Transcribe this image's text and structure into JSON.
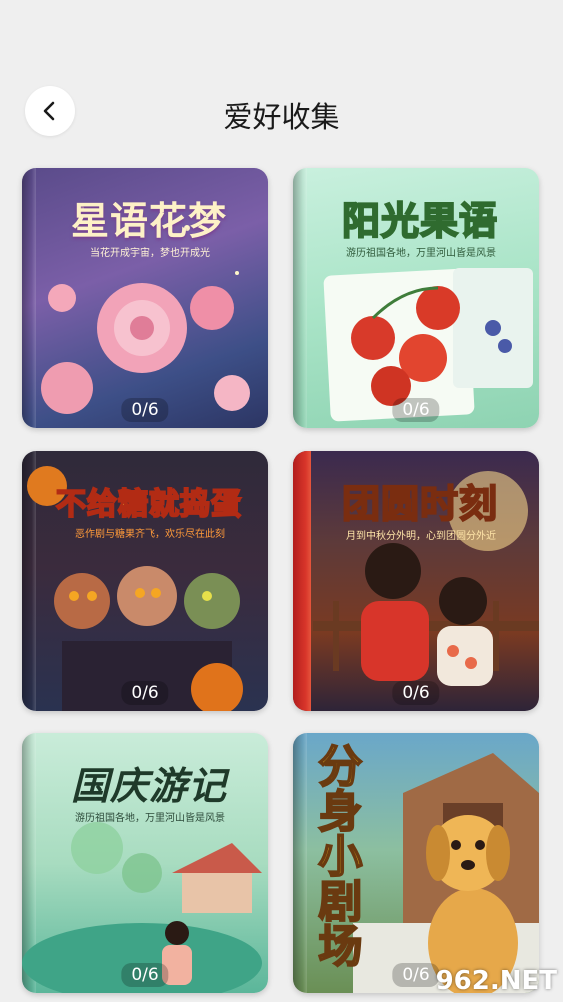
{
  "header": {
    "title": "爱好收集"
  },
  "cards": [
    {
      "title": "星语花梦",
      "subtitle": "当花开成宇宙，梦也开成光",
      "progress": "0/6"
    },
    {
      "title": "阳光果语",
      "subtitle": "游历祖国各地，万里河山皆是风景",
      "progress": "0/6"
    },
    {
      "title": "不给糖就捣蛋",
      "subtitle": "恶作剧与糖果齐飞，欢乐尽在此刻",
      "progress": "0/6"
    },
    {
      "title": "团圆时刻",
      "subtitle": "月到中秋分外明，心到团圆分外近",
      "progress": "0/6"
    },
    {
      "title": "国庆游记",
      "subtitle": "游历祖国各地，万里河山皆是风景",
      "progress": "0/6"
    },
    {
      "title": "分身小剧场",
      "subtitle": "",
      "progress": "0/6"
    }
  ],
  "watermark": "962.NET"
}
